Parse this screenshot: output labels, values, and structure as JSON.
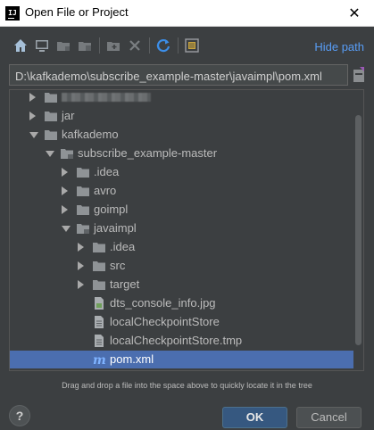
{
  "window": {
    "title": "Open File or Project",
    "app_icon_text": "IJ",
    "close_symbol": "✕"
  },
  "toolbar": {
    "buttons": [
      "home-icon",
      "desktop-icon",
      "project-folder-icon",
      "module-folder-icon",
      "new-folder-icon",
      "delete-icon",
      "refresh-icon",
      "show-hidden-icon"
    ],
    "hide_path_label": "Hide path"
  },
  "path": {
    "value": "D:\\kafkademo\\subscribe_example-master\\javaimpl\\pom.xml"
  },
  "tree": {
    "rows": [
      {
        "label": "",
        "icon": "folder-icon",
        "expanded": false,
        "depth": 0,
        "blurred": true
      },
      {
        "label": "jar",
        "icon": "folder-icon",
        "expanded": false,
        "depth": 0
      },
      {
        "label": "kafkademo",
        "icon": "folder-icon",
        "expanded": true,
        "depth": 0
      },
      {
        "label": "subscribe_example-master",
        "icon": "project-folder-icon",
        "expanded": true,
        "depth": 1
      },
      {
        "label": ".idea",
        "icon": "folder-icon",
        "expanded": false,
        "depth": 2
      },
      {
        "label": "avro",
        "icon": "folder-icon",
        "expanded": false,
        "depth": 2
      },
      {
        "label": "goimpl",
        "icon": "folder-icon",
        "expanded": false,
        "depth": 2
      },
      {
        "label": "javaimpl",
        "icon": "project-folder-icon",
        "expanded": true,
        "depth": 2
      },
      {
        "label": ".idea",
        "icon": "folder-icon",
        "expanded": false,
        "depth": 3
      },
      {
        "label": "src",
        "icon": "folder-icon",
        "expanded": false,
        "depth": 3
      },
      {
        "label": "target",
        "icon": "folder-icon",
        "expanded": false,
        "depth": 3
      },
      {
        "label": "dts_console_info.jpg",
        "icon": "image-file-icon",
        "depth": 3
      },
      {
        "label": "localCheckpointStore",
        "icon": "text-file-icon",
        "depth": 3
      },
      {
        "label": "localCheckpointStore.tmp",
        "icon": "text-file-icon",
        "depth": 3
      },
      {
        "label": "pom.xml",
        "icon": "maven-file-icon",
        "depth": 3,
        "selected": true
      }
    ]
  },
  "hint": "Drag and drop a file into the space above to quickly locate it in the tree",
  "buttons": {
    "help_label": "?",
    "ok_label": "OK",
    "cancel_label": "Cancel"
  },
  "colors": {
    "background": "#3c3f41",
    "selection": "#4b6eaf",
    "link": "#589df6",
    "ok_button": "#365880"
  }
}
